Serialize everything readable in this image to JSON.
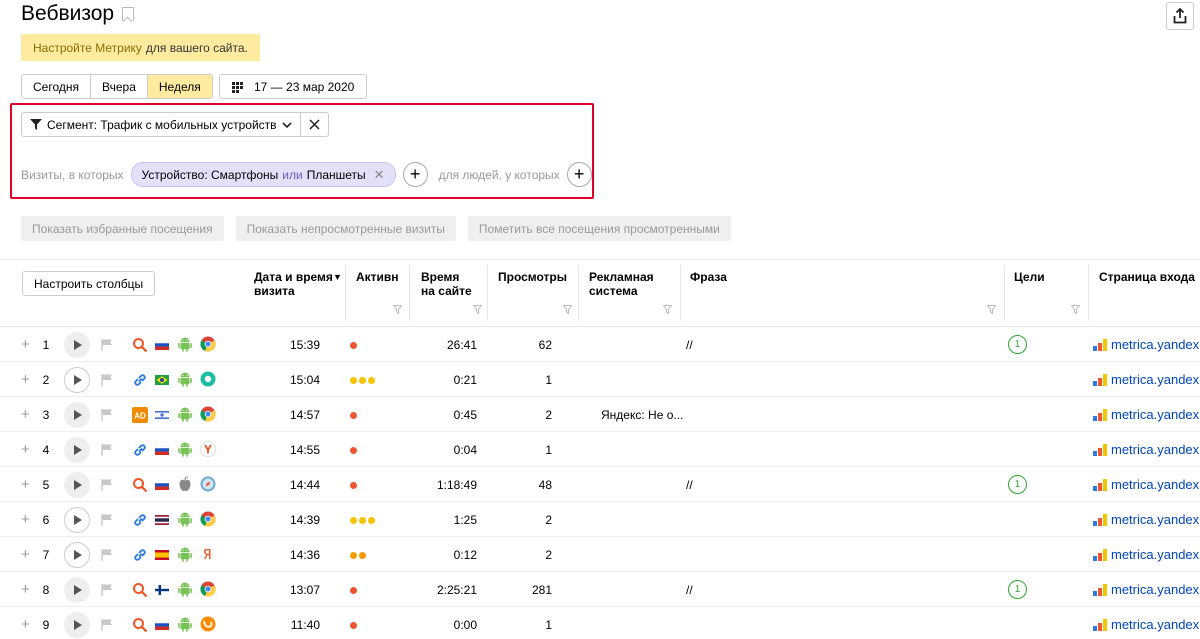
{
  "page": {
    "title": "Вебвизор"
  },
  "notice": {
    "link": "Настройте Метрику",
    "rest": "для вашего сайта."
  },
  "period": {
    "today": "Сегодня",
    "yesterday": "Вчера",
    "week": "Неделя",
    "date_range": "17 — 23 мар 2020"
  },
  "segment": {
    "label": "Сегмент: Трафик с мобильных устройств",
    "visits_label": "Визиты, в которых",
    "chip_prefix": "Устройство: Смартфоны",
    "chip_or": "или",
    "chip_suffix": "Планшеты",
    "people_label": "для людей, у которых"
  },
  "actions": {
    "favorites": "Показать избранные посещения",
    "unviewed": "Показать непросмотренные визиты",
    "mark_viewed": "Пометить все посещения просмотренными"
  },
  "table": {
    "configure": "Настроить столбцы",
    "headers": {
      "datetime": "Дата и время визита",
      "activity": "Активн",
      "duration": "Время на сайте",
      "views": "Просмотры",
      "ad": "Рекламная система",
      "phrase": "Фраза",
      "goals": "Цели",
      "entry": "Страница входа"
    },
    "rows": [
      {
        "n": "1",
        "time": "15:39",
        "dots": [
          "#e53"
        ],
        "dur": "26:41",
        "views": "62",
        "ad": "",
        "phrase": "//",
        "goal": "1",
        "page": "metrica.yandex.c",
        "src": "search",
        "country": "ru",
        "os": "android",
        "browser": "chrome",
        "played": false
      },
      {
        "n": "2",
        "time": "15:04",
        "dots": [
          "#f5c400",
          "#f5c400",
          "#f5c400"
        ],
        "dur": "0:21",
        "views": "1",
        "ad": "",
        "phrase": "",
        "goal": "",
        "page": "metrica.yandex.c",
        "src": "link",
        "country": "br",
        "os": "android",
        "browser": "other",
        "played": true
      },
      {
        "n": "3",
        "time": "14:57",
        "dots": [
          "#e53"
        ],
        "dur": "0:45",
        "views": "2",
        "ad": "Яндекс: Не о...",
        "phrase": "",
        "goal": "",
        "page": "metrica.yandex.c",
        "src": "ad",
        "country": "il",
        "os": "android",
        "browser": "chrome",
        "played": false
      },
      {
        "n": "4",
        "time": "14:55",
        "dots": [
          "#e53"
        ],
        "dur": "0:04",
        "views": "1",
        "ad": "",
        "phrase": "",
        "goal": "",
        "page": "metrica.yandex.c",
        "src": "link",
        "country": "ru",
        "os": "android",
        "browser": "yandex",
        "played": false
      },
      {
        "n": "5",
        "time": "14:44",
        "dots": [
          "#e53"
        ],
        "dur": "1:18:49",
        "views": "48",
        "ad": "",
        "phrase": "//",
        "goal": "1",
        "page": "metrica.yandex.c",
        "src": "search",
        "country": "ru",
        "os": "apple",
        "browser": "safari",
        "played": false
      },
      {
        "n": "6",
        "time": "14:39",
        "dots": [
          "#f5c400",
          "#f5c400",
          "#f5c400"
        ],
        "dur": "1:25",
        "views": "2",
        "ad": "",
        "phrase": "",
        "goal": "",
        "page": "metrica.yandex.c",
        "src": "link",
        "country": "th",
        "os": "android",
        "browser": "chrome",
        "played": true
      },
      {
        "n": "7",
        "time": "14:36",
        "dots": [
          "#f59c00",
          "#f59c00"
        ],
        "dur": "0:12",
        "views": "2",
        "ad": "",
        "phrase": "",
        "goal": "",
        "page": "metrica.yandex.c",
        "src": "link",
        "country": "es",
        "os": "android",
        "browser": "yabrowser",
        "played": true
      },
      {
        "n": "8",
        "time": "13:07",
        "dots": [
          "#e53"
        ],
        "dur": "2:25:21",
        "views": "281",
        "ad": "",
        "phrase": "//",
        "goal": "1",
        "page": "metrica.yandex.c",
        "src": "search",
        "country": "fi",
        "os": "android",
        "browser": "chrome",
        "played": false
      },
      {
        "n": "9",
        "time": "11:40",
        "dots": [
          "#e53"
        ],
        "dur": "0:00",
        "views": "1",
        "ad": "",
        "phrase": "",
        "goal": "",
        "page": "metrica.yandex.c",
        "src": "search",
        "country": "ru",
        "os": "android",
        "browser": "uc",
        "played": false
      }
    ]
  },
  "colors": {
    "accent": "#ffeba0",
    "highlight_border": "#e0002a",
    "link": "#0044bb",
    "goal": "#2ea52e"
  }
}
